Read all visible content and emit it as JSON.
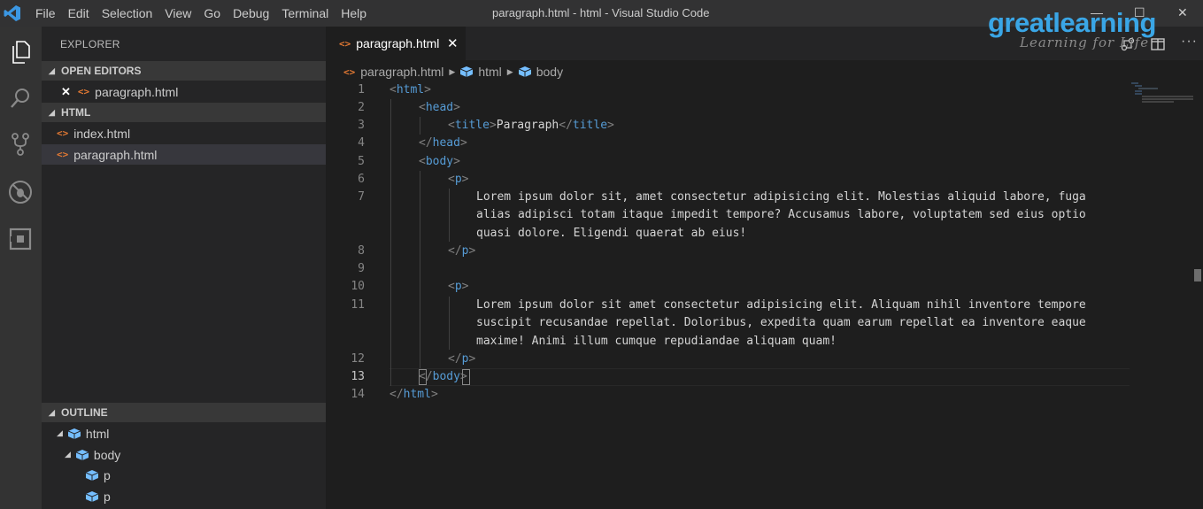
{
  "menu": [
    "File",
    "Edit",
    "Selection",
    "View",
    "Go",
    "Debug",
    "Terminal",
    "Help"
  ],
  "window_title": "paragraph.html - html - Visual Studio Code",
  "window_controls": {
    "minimize": "—",
    "maximize": "☐",
    "close": "✕"
  },
  "watermark": {
    "brand": "greatlearning",
    "tagline": "Learning for Life"
  },
  "sidebar": {
    "title": "EXPLORER",
    "open_editors": {
      "header": "OPEN EDITORS",
      "items": [
        {
          "label": "paragraph.html"
        }
      ]
    },
    "folder": {
      "header": "HTML",
      "items": [
        {
          "label": "index.html"
        },
        {
          "label": "paragraph.html",
          "selected": true
        }
      ]
    },
    "outline": {
      "header": "OUTLINE",
      "items": [
        {
          "label": "html"
        },
        {
          "label": "body"
        },
        {
          "label": "p"
        },
        {
          "label": "p"
        }
      ]
    }
  },
  "tab": {
    "label": "paragraph.html",
    "close": "✕"
  },
  "breadcrumb": [
    "paragraph.html",
    "html",
    "body"
  ],
  "editor": {
    "line_numbers": [
      "1",
      "2",
      "3",
      "4",
      "5",
      "6",
      "7",
      "8",
      "9",
      "10",
      "11",
      "12",
      "13",
      "14"
    ],
    "active_line": "13",
    "lines": [
      {
        "open": "<",
        "tag": "html",
        "close": ">"
      },
      {
        "open": "<",
        "tag": "head",
        "close": ">"
      },
      {
        "open": "<",
        "tag": "title",
        "close": ">",
        "text": "Paragraph",
        "end_open": "</",
        "end_tag": "title",
        "end_close": ">"
      },
      {
        "open": "</",
        "tag": "head",
        "close": ">"
      },
      {
        "open": "<",
        "tag": "body",
        "close": ">"
      },
      {
        "open": "<",
        "tag": "p",
        "close": ">"
      },
      {
        "text": "Lorem ipsum dolor sit, amet consectetur adipisicing elit. Molestias aliquid labore, fuga"
      },
      {
        "text": "alias adipisci totam itaque impedit tempore? Accusamus labore, voluptatem sed eius optio"
      },
      {
        "text": "quasi dolore. Eligendi quaerat ab eius!"
      },
      {
        "open": "</",
        "tag": "p",
        "close": ">"
      },
      {
        "open": "<",
        "tag": "p",
        "close": ">"
      },
      {
        "text": "Lorem ipsum dolor sit amet consectetur adipisicing elit. Aliquam nihil inventore tempore"
      },
      {
        "text": "suscipit recusandae repellat. Doloribus, expedita quam earum repellat ea inventore eaque"
      },
      {
        "text": "maxime! Animi illum cumque repudiandae aliquam quam!"
      },
      {
        "open": "</",
        "tag": "p",
        "close": ">"
      },
      {
        "open": "</",
        "tag": "body",
        "close": ">"
      },
      {
        "open": "</",
        "tag": "html",
        "close": ">"
      }
    ]
  },
  "colors": {
    "accent": "#007acc",
    "tag": "#569cd6",
    "punctuation": "#808080",
    "html_icon": "#e37933",
    "brand": "#3aa6e6"
  }
}
